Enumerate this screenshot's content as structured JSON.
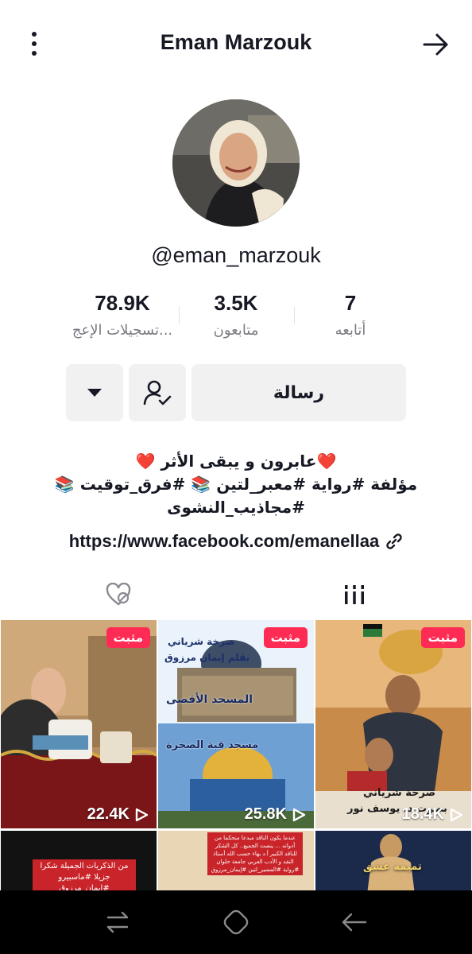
{
  "header": {
    "title": "Eman Marzouk"
  },
  "profile": {
    "handle": "@eman_marzouk"
  },
  "stats": [
    {
      "value": "78.9K",
      "label": "تسجيلات الإعج..."
    },
    {
      "value": "3.5K",
      "label": "متابعون"
    },
    {
      "value": "7",
      "label": "أتابعه"
    }
  ],
  "actions": {
    "message_label": "رسالة"
  },
  "bio": {
    "line1": "❤️عابرون و يبقى الأثر ❤️",
    "line2": "مؤلفة #رواية #معبر_لتين 📚 #فرق_توقيت 📚",
    "line3": "#مجاذيب_النشوى",
    "link": "https://www.facebook.com/emanellaa"
  },
  "videos": [
    {
      "pinned_label": "مثبت",
      "views": "22.4K",
      "caption": ""
    },
    {
      "pinned_label": "مثبت",
      "views": "25.8K",
      "caption": "صرخة شرياني",
      "caption2": "بقلم إيمان مرزوق",
      "caption3": "المسجد الأقصى",
      "caption4": "مسجد قبة الصخرة"
    },
    {
      "pinned_label": "مثبت",
      "views": "18.4K",
      "caption": "صرخة شرياني",
      "caption2": "بصوت د. يوسف نور"
    },
    {
      "caption": "من الذكريات الجميلة شكرا جزيلا #ماسبيرو #إيمان_مرزوق"
    },
    {
      "caption": "عندما يكون الناقد مبدعا منحكما من أدواته ... ينصت الجميع.. كل الشكر للناقد الكبير أ.د بهاء حسب الله أستاذ النقد و الأدب العربي جامعة حلوان #رواية #المسير_لتين #إيمان_مرزوق"
    },
    {
      "caption": "تميمة عشق"
    }
  ],
  "colors": {
    "accent": "#fe2c55",
    "text": "#161823",
    "muted": "#7a7b82",
    "button_bg": "#f1f1f2"
  }
}
